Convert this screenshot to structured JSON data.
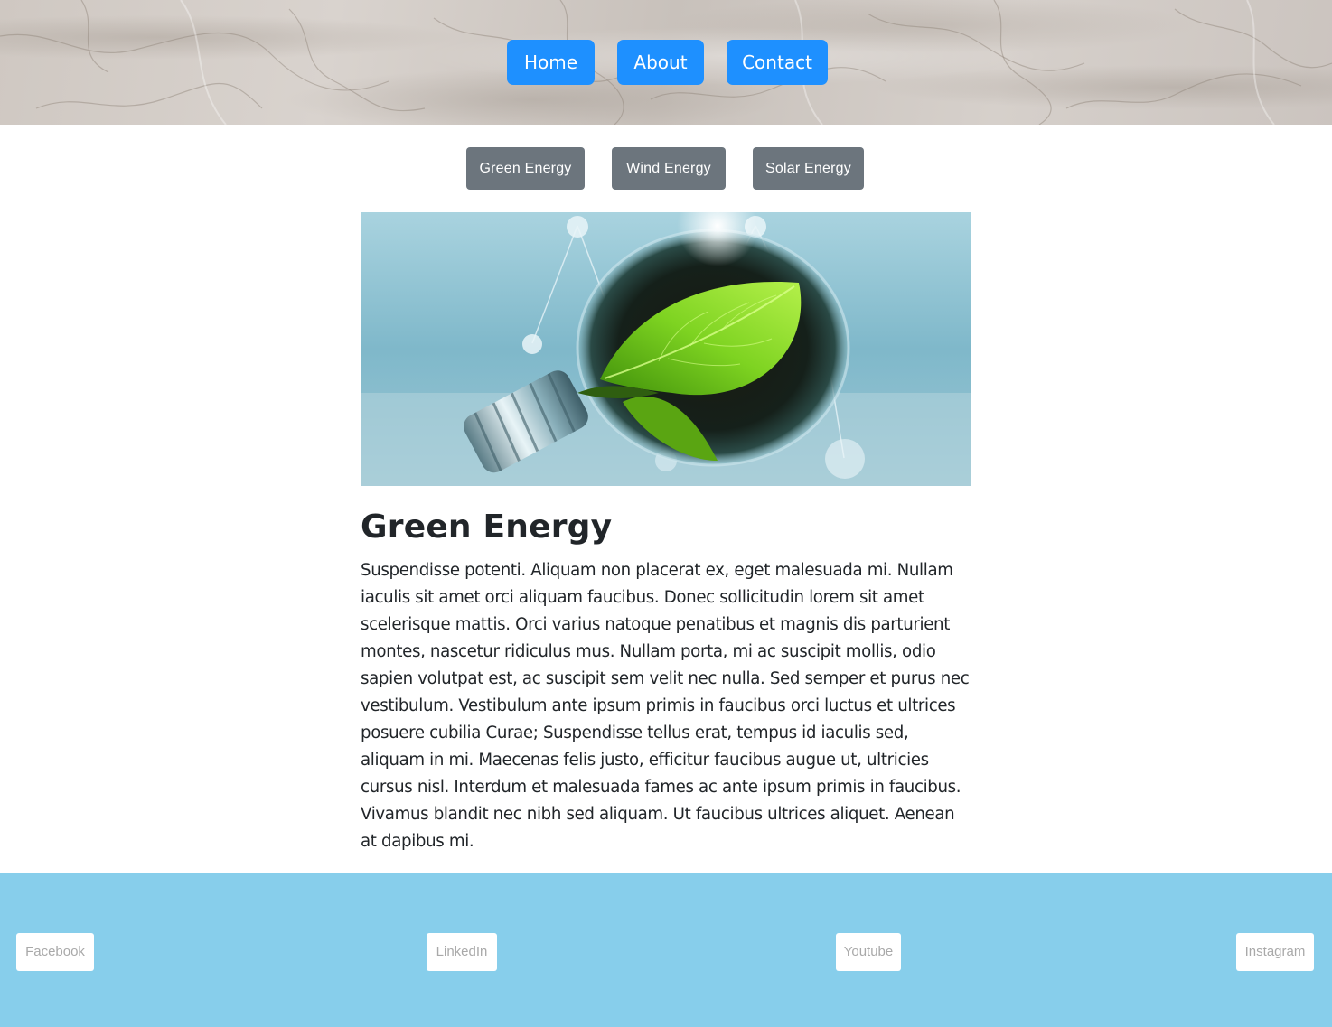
{
  "nav": {
    "home_label": "Home",
    "about_label": "About",
    "contact_label": "Contact"
  },
  "categories": {
    "green_label": "Green Energy",
    "wind_label": "Wind Energy",
    "solar_label": "Solar Energy"
  },
  "hero": {
    "icon": "lightbulb-leaf-image"
  },
  "article": {
    "title": "Green Energy",
    "body": "Suspendisse potenti. Aliquam non placerat ex, eget malesuada mi. Nullam iaculis sit amet orci aliquam faucibus. Donec sollicitudin lorem sit amet scelerisque mattis. Orci varius natoque penatibus et magnis dis parturient montes, nascetur ridiculus mus. Nullam porta, mi ac suscipit mollis, odio sapien volutpat est, ac suscipit sem velit nec nulla. Sed semper et purus nec vestibulum. Vestibulum ante ipsum primis in faucibus orci luctus et ultrices posuere cubilia Curae; Suspendisse tellus erat, tempus id iaculis sed, aliquam in mi. Maecenas felis justo, efficitur faucibus augue ut, ultricies cursus nisl. Interdum et malesuada fames ac ante ipsum primis in faucibus. Vivamus blandit nec nibh sed aliquam. Ut faucibus ultrices aliquet. Aenean at dapibus mi."
  },
  "footer": {
    "facebook_label": "Facebook",
    "linkedin_label": "LinkedIn",
    "youtube_label": "Youtube",
    "instagram_label": "Instagram"
  },
  "colors": {
    "nav_button": "#1e90ff",
    "category_button": "#6c757d",
    "footer_background": "#87ceeb",
    "text": "#212529",
    "social_text": "#a9a9a9"
  }
}
